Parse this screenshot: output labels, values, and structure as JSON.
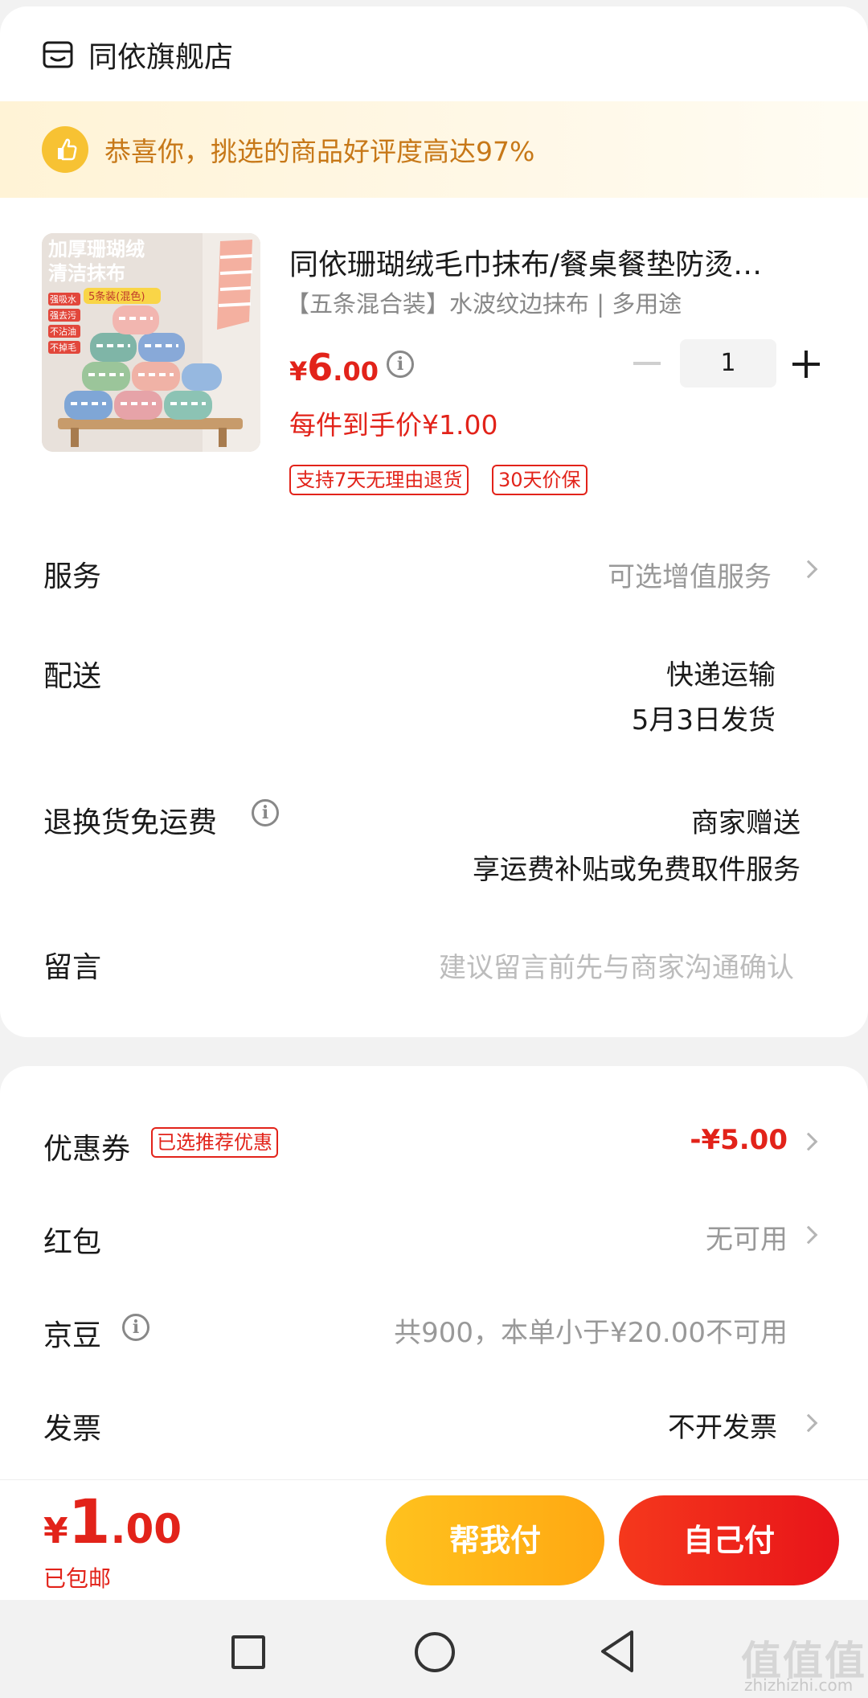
{
  "store": {
    "name": "同依旗舰店",
    "icon": "store-icon"
  },
  "banner": {
    "text": "恭喜你，挑选的商品好评度高达97%",
    "icon": "thumbs-up-icon"
  },
  "product": {
    "image_text_line1": "加厚珊瑚绒",
    "image_text_line2": "清洁抹布",
    "image_badge": "5条装(混色)",
    "image_features": [
      "强吸水",
      "强去污",
      "不沾油",
      "不掉毛"
    ],
    "title": "同依珊瑚绒毛巾抹布/餐桌餐垫防烫…",
    "spec": "【五条混合装】水波纹边抹布 | 多用途",
    "price_symbol": "¥",
    "price_int": "6",
    "price_dec": ".00",
    "per_price": "每件到手价¥1.00",
    "tags": [
      "支持7天无理由退货",
      "30天价保"
    ],
    "quantity": "1"
  },
  "rows": {
    "service": {
      "label": "服务",
      "value": "可选增值服务"
    },
    "delivery": {
      "label": "配送",
      "value1": "快递运输",
      "value2": "5月3日发货"
    },
    "returns": {
      "label": "退换货免运费",
      "value1": "商家赠送",
      "value2": "享运费补贴或免费取件服务"
    },
    "message": {
      "label": "留言",
      "placeholder": "建议留言前先与商家沟通确认"
    }
  },
  "discounts": {
    "coupon": {
      "label": "优惠券",
      "tag": "已选推荐优惠",
      "value": "-¥5.00"
    },
    "redpacket": {
      "label": "红包",
      "value": "无可用"
    },
    "jingdou": {
      "label": "京豆",
      "value": "共900，本单小于¥20.00不可用"
    },
    "invoice": {
      "label": "发票",
      "value": "不开发票"
    }
  },
  "footer": {
    "total_symbol": "¥",
    "total_int": "1",
    "total_dec": ".00",
    "shipping": "已包邮",
    "help_pay": "帮我付",
    "self_pay": "自己付"
  },
  "watermark": {
    "main": "值值值",
    "sub": "zhizhizhi.com"
  },
  "colors": {
    "price_red": "#e2231a",
    "banner_text": "#c77818",
    "help_btn": "#ffb81a",
    "self_btn": "#ee2a1b"
  }
}
